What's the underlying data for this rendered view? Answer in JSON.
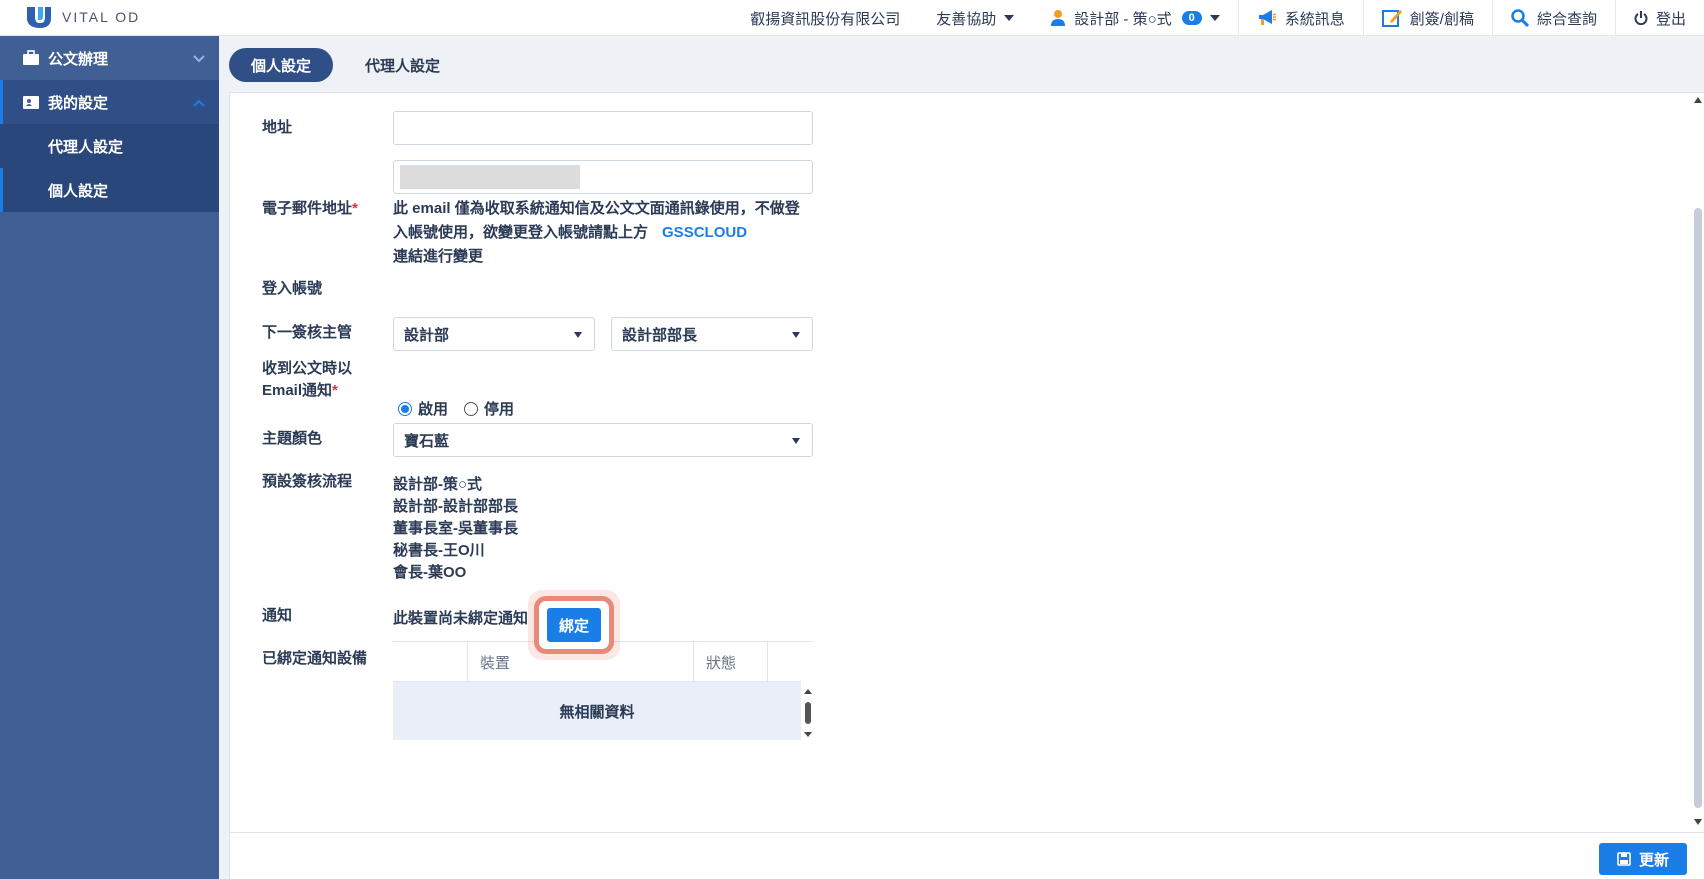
{
  "brand": {
    "name": "VITAL OD"
  },
  "topbar": {
    "company": "叡揚資訊股份有限公司",
    "help": "友善協助",
    "user": "設計部 - 策○式",
    "user_badge": "0",
    "messages": "系統訊息",
    "draft": "創簽/創稿",
    "query": "綜合查詢",
    "logout": "登出"
  },
  "sidebar": {
    "items": [
      {
        "label": "公文辦理"
      },
      {
        "label": "我的設定"
      }
    ],
    "sub_items": [
      {
        "label": "代理人設定"
      },
      {
        "label": "個人設定"
      }
    ]
  },
  "tabs": [
    {
      "label": "個人設定",
      "active": true
    },
    {
      "label": "代理人設定",
      "active": false
    }
  ],
  "form": {
    "address_label": "地址",
    "address_value": "",
    "email_label": "電子郵件地址",
    "email_note": "此 email 僅為收取系統通知信及公文文面通訊錄使用，不做登入帳號使用，欲變更登入帳號請點上方",
    "email_link": "GSSCLOUD",
    "email_note_tail": "連結進行變更",
    "login_label": "登入帳號",
    "supervisor_label": "下一簽核主管",
    "supervisor_dept": "設計部",
    "supervisor_person": "設計部部長",
    "notify_email_label_1": "收到公文時以",
    "notify_email_label_2": "Email通知",
    "radio_on": "啟用",
    "radio_off": "停用",
    "theme_label": "主題顏色",
    "theme_value": "寶石藍",
    "flow_label": "預設簽核流程",
    "flow": [
      "設計部-策○式",
      "設計部-設計部部長",
      "董事長室-吳董事長",
      "秘書長-王O川",
      "會長-葉OO"
    ],
    "notify_label": "通知",
    "notify_text": "此裝置尚未綁定通知",
    "bind_button": "綁定",
    "devices_label": "已綁定通知設備",
    "devices_columns": [
      "裝置",
      "狀態"
    ],
    "devices_empty": "無相關資料"
  },
  "footer": {
    "update_button": "更新"
  },
  "colors": {
    "accent": "#1b7ee6",
    "sidebar": "#3f5f95",
    "highlight": "#e98a78"
  }
}
